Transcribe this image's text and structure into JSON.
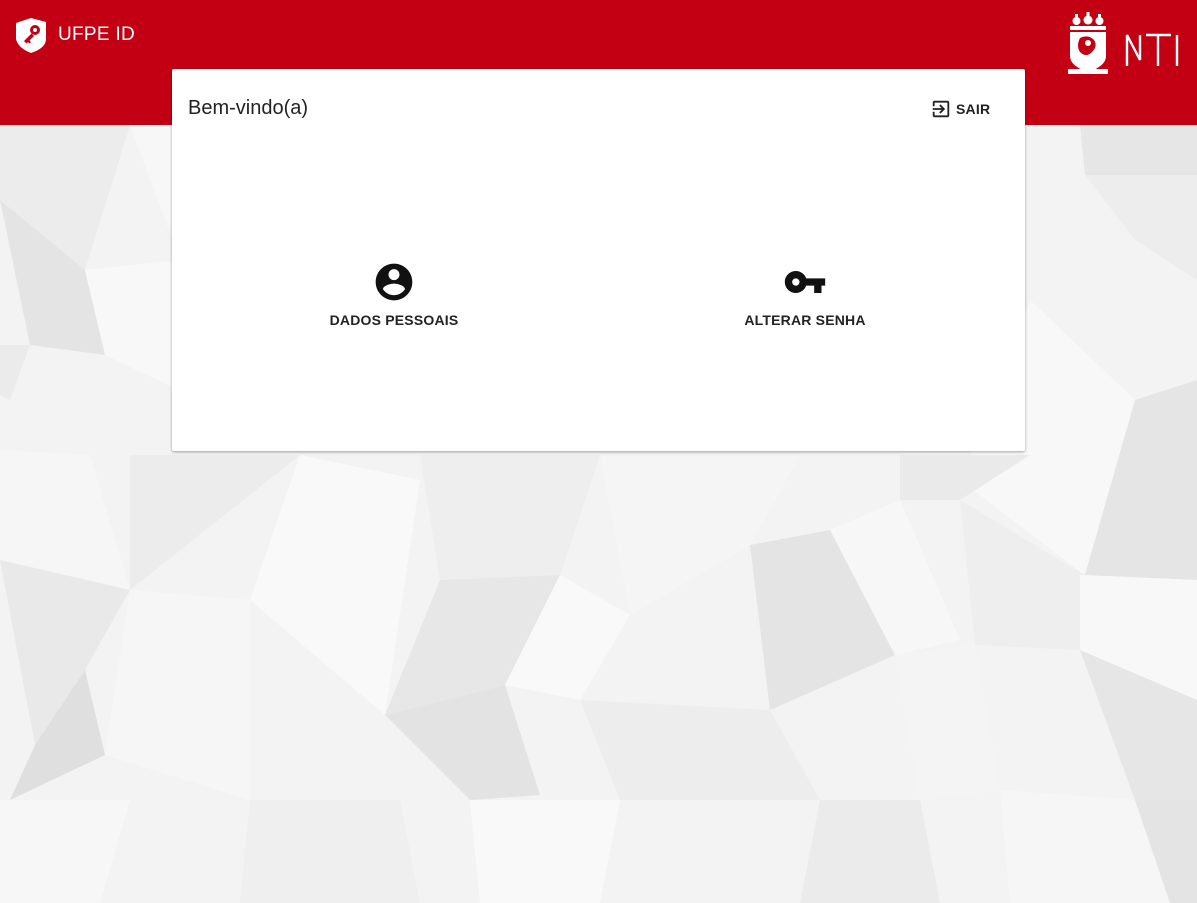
{
  "header": {
    "app_title": "UFPE ID",
    "brand_color": "#c30013",
    "logos": [
      "ufpe-id-logo",
      "ufpe-crest-logo",
      "nti-logo"
    ]
  },
  "card": {
    "title": "Bem-vindo(a)",
    "logout": {
      "label": "SAIR",
      "icon": "exit-to-app-icon"
    },
    "actions": [
      {
        "label": "DADOS PESSOAIS",
        "icon": "account-circle-icon"
      },
      {
        "label": "ALTERAR SENHA",
        "icon": "vpn-key-icon"
      }
    ]
  }
}
